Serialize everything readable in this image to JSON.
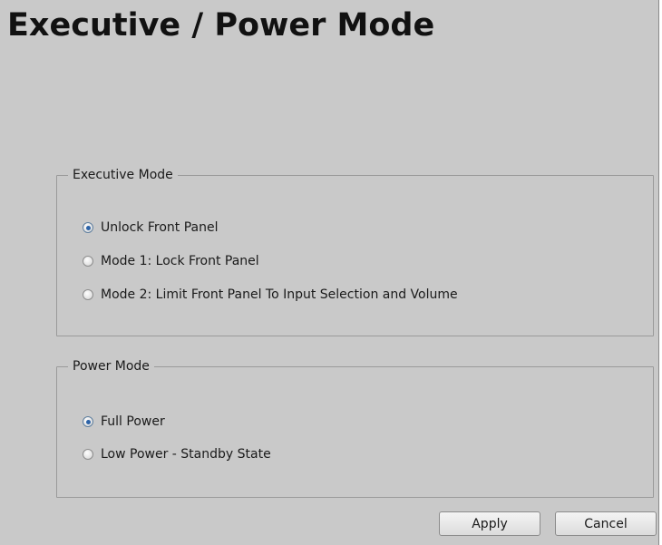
{
  "page": {
    "title": "Executive / Power Mode"
  },
  "executive_mode": {
    "legend": "Executive Mode",
    "options": [
      {
        "label": "Unlock Front Panel",
        "checked": true
      },
      {
        "label": "Mode 1: Lock Front Panel",
        "checked": false
      },
      {
        "label": "Mode 2: Limit Front Panel To Input Selection and Volume",
        "checked": false
      }
    ]
  },
  "power_mode": {
    "legend": "Power Mode",
    "options": [
      {
        "label": "Full Power",
        "checked": true
      },
      {
        "label": "Low Power - Standby State",
        "checked": false
      }
    ]
  },
  "buttons": {
    "apply": "Apply",
    "cancel": "Cancel"
  }
}
